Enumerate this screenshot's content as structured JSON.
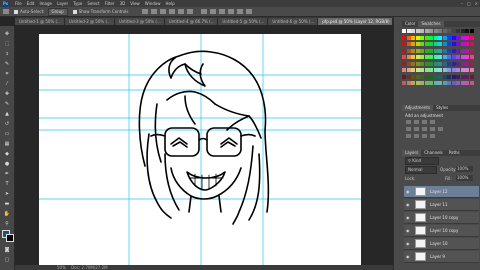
{
  "menubar": {
    "logo": "Ps",
    "items": [
      "File",
      "Edit",
      "Image",
      "Layer",
      "Type",
      "Select",
      "Filter",
      "3D",
      "View",
      "Window",
      "Help"
    ]
  },
  "optionsbar": {
    "auto_select_label": "Auto-Select:",
    "auto_select_value": "Group",
    "show_transform_label": "Show Transform Controls"
  },
  "tabs": [
    {
      "label": "Untitled-1 @ 50% (..."
    },
    {
      "label": "Untitled-2 @ 50% (..."
    },
    {
      "label": "Untitled-3 @ 50% (..."
    },
    {
      "label": "Untitled-4 @ 66.7% (..."
    },
    {
      "label": "Untitled-5 @ 50% (..."
    },
    {
      "label": "Untitled-6 @ 50% (..."
    },
    {
      "label": "pfp.psd @ 50% (Layer 12, RGB/8)"
    }
  ],
  "status": {
    "zoom": "50%",
    "doc": "Doc: 2.70M/27.2M"
  },
  "panels": {
    "color_tabs": [
      "Color",
      "Swatches"
    ],
    "adjust_tabs": [
      "Adjustments",
      "Styles"
    ],
    "adjust_title": "Add an adjustment",
    "layer_tabs": [
      "Layers",
      "Channels",
      "Paths"
    ],
    "kind_label": "Kind",
    "blend_mode": "Normal",
    "opacity_label": "Opacity:",
    "opacity_value": "100%",
    "lock_label": "Lock:",
    "fill_label": "Fill:",
    "fill_value": "100%"
  },
  "layers": [
    {
      "name": "Layer 12"
    },
    {
      "name": "Layer 11"
    },
    {
      "name": "Layer 10 copy"
    },
    {
      "name": "Layer 10 copy"
    },
    {
      "name": "Layer 10"
    },
    {
      "name": "Layer 9"
    }
  ],
  "colors": {
    "accent_selected": "#6d7f96",
    "guide": "#29c6f0"
  }
}
